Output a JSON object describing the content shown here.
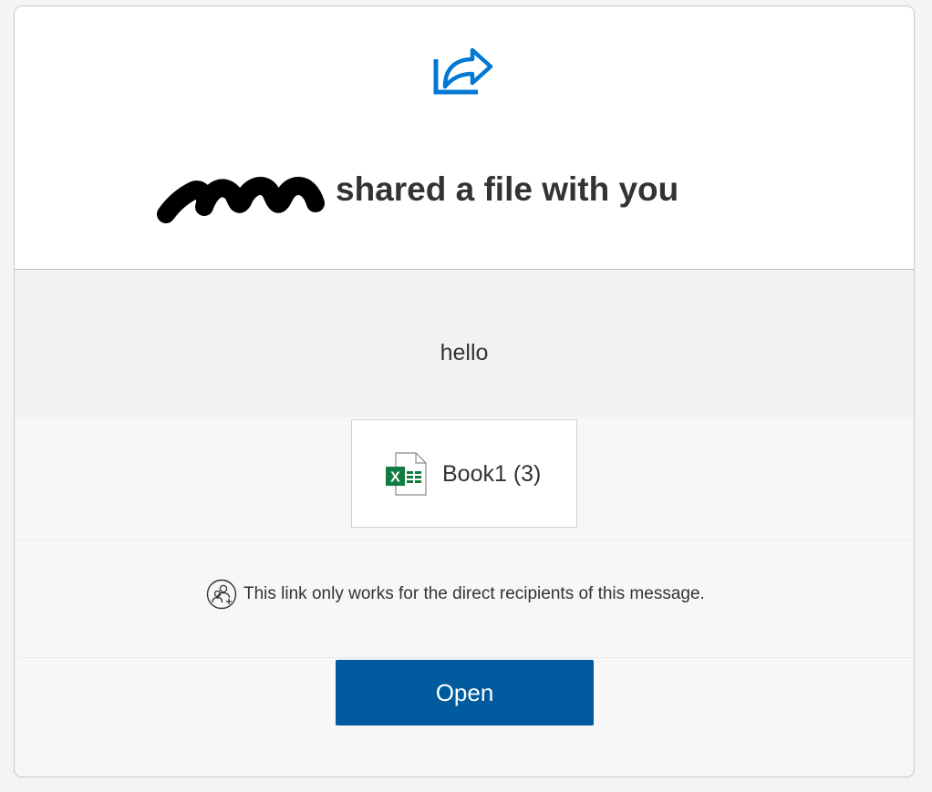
{
  "header": {
    "icon": "share-arrow-icon",
    "title_suffix": "shared a file with you",
    "accent_color": "#0078d4"
  },
  "message": {
    "text": "hello"
  },
  "file": {
    "name": "Book1 (3)",
    "icon": "excel-file-icon",
    "icon_color": "#107c41"
  },
  "notice": {
    "icon": "people-icon",
    "text": "This link only works for the direct recipients of this message."
  },
  "actions": {
    "open_label": "Open",
    "button_color": "#005a9e"
  }
}
